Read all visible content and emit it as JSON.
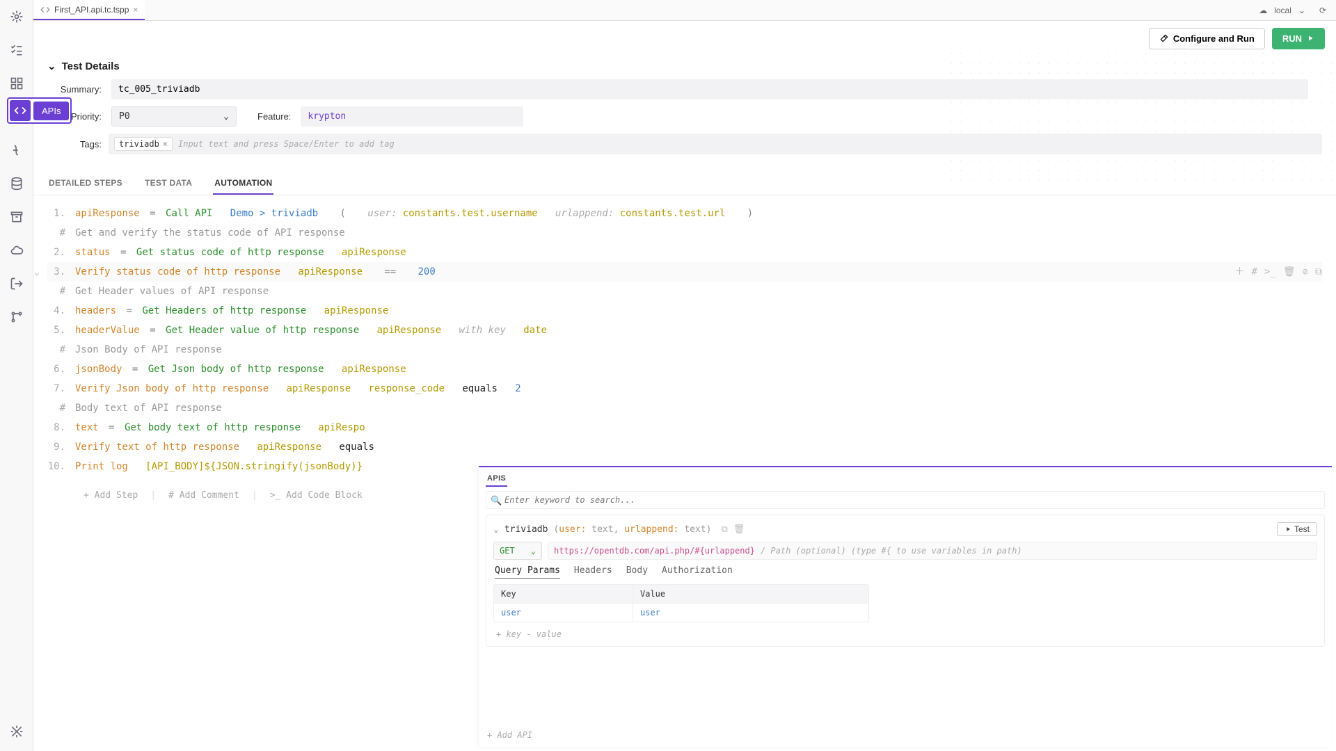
{
  "file_tab": {
    "name": "First_API.api.tc.tspp"
  },
  "toolbar": {
    "env": "local",
    "configure": "Configure and Run",
    "run": "RUN"
  },
  "apis_bubble": "APIs",
  "details": {
    "heading": "Test Details",
    "summary_label": "Summary:",
    "summary_value": "tc_005_triviadb",
    "priority_label": "Priority:",
    "priority_value": "P0",
    "feature_label": "Feature:",
    "feature_value": "krypton",
    "tags_label": "Tags:",
    "tag_chip": "triviadb",
    "tags_placeholder": "Input text and press Space/Enter to add tag"
  },
  "subtabs": {
    "a": "DETAILED STEPS",
    "b": "TEST DATA",
    "c": "AUTOMATION"
  },
  "lines": {
    "l1": {
      "n": "1.",
      "var": "apiResponse",
      "op": "=",
      "cmd": "Call API",
      "demo": "Demo > triviadb",
      "lp": "(",
      "user_l": "user:",
      "user_v": "constants.test.username",
      "url_l": "urlappend:",
      "url_v": "constants.test.url",
      "rp": ")"
    },
    "c1": {
      "mark": "#",
      "text": "Get and verify the status code of API response"
    },
    "l2": {
      "n": "2.",
      "var": "status",
      "op": "=",
      "cmd": "Get status code of http response",
      "arg": "apiResponse"
    },
    "l3": {
      "n": "3.",
      "cmd": "Verify status code of http response",
      "arg": "apiResponse",
      "op": "==",
      "val": "200"
    },
    "c2": {
      "mark": "#",
      "text": "Get Header values of API response"
    },
    "l4": {
      "n": "4.",
      "var": "headers",
      "op": "=",
      "cmd": "Get Headers of http response",
      "arg": "apiResponse"
    },
    "l5": {
      "n": "5.",
      "var": "headerValue",
      "op": "=",
      "cmd": "Get Header value of http response",
      "arg": "apiResponse",
      "wk": "with key",
      "key": "date"
    },
    "c3": {
      "mark": "#",
      "text": "Json Body of API response"
    },
    "l6": {
      "n": "6.",
      "var": "jsonBody",
      "op": "=",
      "cmd": "Get Json body of http response",
      "arg": "apiResponse"
    },
    "l7": {
      "n": "7.",
      "cmd": "Verify Json body of http response",
      "arg": "apiResponse",
      "field": "response_code",
      "eq": "equals",
      "val": "2"
    },
    "c4": {
      "mark": "#",
      "text": "Body text of API response"
    },
    "l8": {
      "n": "8.",
      "var": "text",
      "op": "=",
      "cmd": "Get body text of http response",
      "arg": "apiRespo"
    },
    "l9": {
      "n": "9.",
      "cmd": "Verify text of http response",
      "arg": "apiResponse",
      "eq": "equals"
    },
    "l10": {
      "n": "10.",
      "cmd": "Print log",
      "arg": "[API_BODY]${JSON.stringify(jsonBody)}"
    }
  },
  "addrow": {
    "step": "+ Add Step",
    "comment": "# Add Comment",
    "code": ">_ Add Code Block"
  },
  "apis_panel": {
    "title": "APIS",
    "search_ph": "Enter keyword to search...",
    "item": {
      "name": "triviadb",
      "sig_open": "(",
      "sig_u": "user:",
      "sig_ut": "text",
      "sig_c": ", ",
      "sig_a": "urlappend:",
      "sig_at": "text",
      "sig_close": ")",
      "test": "Test",
      "method": "GET",
      "url": "https://opentdb.com/api.php/#{urlappend}",
      "url_hint": "/ Path (optional) (type #{ to use variables in path)",
      "tabs": {
        "qp": "Query Params",
        "h": "Headers",
        "b": "Body",
        "a": "Authorization"
      },
      "kv_hdr_k": "Key",
      "kv_hdr_v": "Value",
      "kv_k": "user",
      "kv_v": "user",
      "add_kv": "+ key - value"
    },
    "add_api": "+ Add API"
  }
}
